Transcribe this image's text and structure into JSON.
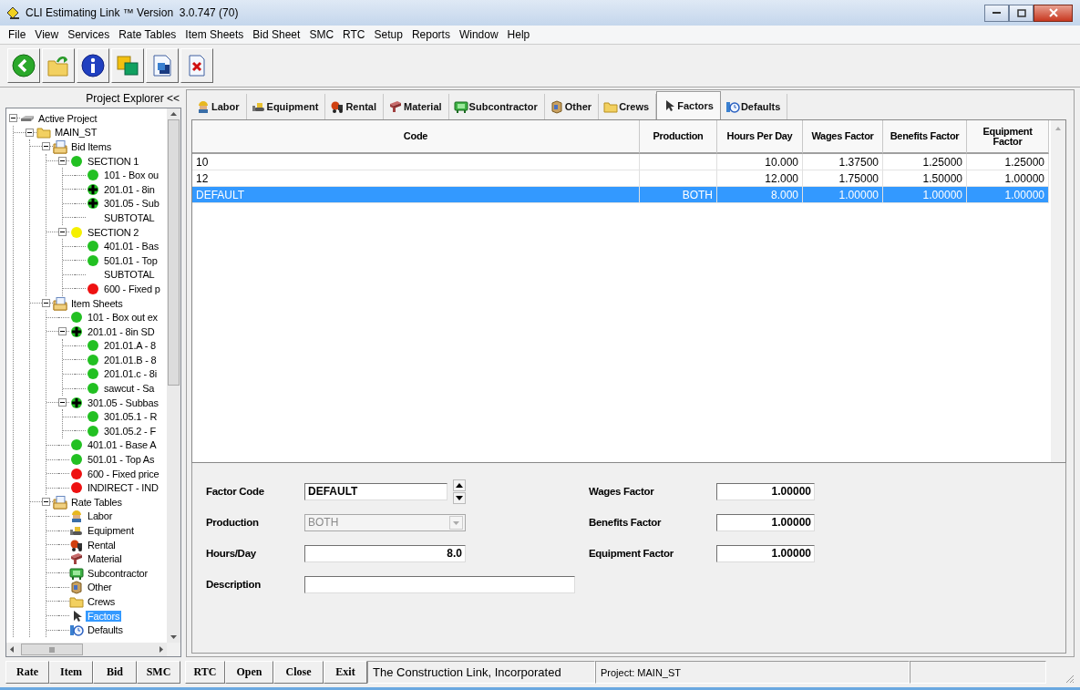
{
  "window": {
    "title": "CLI Estimating Link ™ Version  3.0.747 (70)"
  },
  "menu": [
    "File",
    "View",
    "Services",
    "Rate Tables",
    "Item Sheets",
    "Bid Sheet",
    "SMC",
    "RTC",
    "Setup",
    "Reports",
    "Window",
    "Help"
  ],
  "explorer": {
    "title": "Project Explorer <<",
    "tree": [
      {
        "label": "Active Project",
        "kind": "project",
        "expanded": true,
        "selected": false,
        "children": [
          {
            "label": "MAIN_ST",
            "kind": "folder",
            "expanded": true,
            "selected": false,
            "children": [
              {
                "label": "Bid Items",
                "kind": "sheets",
                "expanded": true,
                "selected": false,
                "children": [
                  {
                    "label": "SECTION 1",
                    "kind": "status",
                    "color": "#22c022",
                    "expanded": true,
                    "selected": false,
                    "children": [
                      {
                        "label": "101 - Box ou",
                        "kind": "status",
                        "color": "#22c022",
                        "selected": false
                      },
                      {
                        "label": "201.01 - 8in",
                        "kind": "assembly",
                        "color": "#22c022",
                        "selected": false
                      },
                      {
                        "label": "301.05 - Sub",
                        "kind": "assembly",
                        "color": "#22c022",
                        "selected": false
                      },
                      {
                        "label": "SUBTOTAL",
                        "kind": "subtotal",
                        "selected": false
                      }
                    ]
                  },
                  {
                    "label": "SECTION 2",
                    "kind": "status",
                    "color": "#f5f000",
                    "expanded": true,
                    "selected": false,
                    "children": [
                      {
                        "label": "401.01 - Bas",
                        "kind": "status",
                        "color": "#22c022",
                        "selected": false
                      },
                      {
                        "label": "501.01 - Top",
                        "kind": "status",
                        "color": "#22c022",
                        "selected": false
                      },
                      {
                        "label": "SUBTOTAL",
                        "kind": "subtotal",
                        "selected": false
                      },
                      {
                        "label": "600 - Fixed p",
                        "kind": "status",
                        "color": "#ee1111",
                        "selected": false
                      }
                    ]
                  }
                ]
              },
              {
                "label": "Item Sheets",
                "kind": "sheets",
                "expanded": true,
                "selected": false,
                "children": [
                  {
                    "label": "101 - Box out ex",
                    "kind": "status",
                    "color": "#22c022",
                    "selected": false
                  },
                  {
                    "label": "201.01 - 8in SD",
                    "kind": "assembly",
                    "color": "#22c022",
                    "expanded": true,
                    "selected": false,
                    "children": [
                      {
                        "label": "201.01.A - 8",
                        "kind": "status",
                        "color": "#22c022",
                        "selected": false
                      },
                      {
                        "label": "201.01.B - 8",
                        "kind": "status",
                        "color": "#22c022",
                        "selected": false
                      },
                      {
                        "label": "201.01.c - 8i",
                        "kind": "status",
                        "color": "#22c022",
                        "selected": false
                      },
                      {
                        "label": "sawcut - Sa",
                        "kind": "status",
                        "color": "#22c022",
                        "selected": false
                      }
                    ]
                  },
                  {
                    "label": "301.05 - Subbas",
                    "kind": "assembly",
                    "color": "#22c022",
                    "expanded": true,
                    "selected": false,
                    "children": [
                      {
                        "label": "301.05.1 - R",
                        "kind": "status",
                        "color": "#22c022",
                        "selected": false
                      },
                      {
                        "label": "301.05.2 - F",
                        "kind": "status",
                        "color": "#22c022",
                        "selected": false
                      }
                    ]
                  },
                  {
                    "label": "401.01 - Base A",
                    "kind": "status",
                    "color": "#22c022",
                    "selected": false
                  },
                  {
                    "label": "501.01 - Top As",
                    "kind": "status",
                    "color": "#22c022",
                    "selected": false
                  },
                  {
                    "label": "600 - Fixed price",
                    "kind": "status",
                    "color": "#ee1111",
                    "selected": false
                  },
                  {
                    "label": "INDIRECT - IND",
                    "kind": "status",
                    "color": "#ee1111",
                    "selected": false
                  }
                ]
              },
              {
                "label": "Rate Tables",
                "kind": "sheets",
                "expanded": true,
                "selected": false,
                "children": [
                  {
                    "label": "Labor",
                    "kind": "rate-table",
                    "selected": false
                  },
                  {
                    "label": "Equipment",
                    "kind": "rate-table",
                    "selected": false
                  },
                  {
                    "label": "Rental",
                    "kind": "rate-table",
                    "selected": false
                  },
                  {
                    "label": "Material",
                    "kind": "rate-table",
                    "selected": false
                  },
                  {
                    "label": "Subcontractor",
                    "kind": "rate-table",
                    "selected": false
                  },
                  {
                    "label": "Other",
                    "kind": "rate-table",
                    "selected": false
                  },
                  {
                    "label": "Crews",
                    "kind": "rate-table",
                    "selected": false
                  },
                  {
                    "label": "Factors",
                    "kind": "rate-table",
                    "selected": true
                  },
                  {
                    "label": "Defaults",
                    "kind": "rate-table",
                    "selected": false
                  }
                ]
              }
            ]
          }
        ]
      }
    ]
  },
  "tabs": [
    {
      "label": "Labor",
      "selected": false
    },
    {
      "label": "Equipment",
      "selected": false
    },
    {
      "label": "Rental",
      "selected": false
    },
    {
      "label": "Material",
      "selected": false
    },
    {
      "label": "Subcontractor",
      "selected": false
    },
    {
      "label": "Other",
      "selected": false
    },
    {
      "label": "Crews",
      "selected": false
    },
    {
      "label": "Factors",
      "selected": true
    },
    {
      "label": "Defaults",
      "selected": false
    }
  ],
  "grid": {
    "columns": [
      "Code",
      "Production",
      "Hours Per Day",
      "Wages Factor",
      "Benefits Factor",
      "Equipment Factor"
    ],
    "rows": [
      {
        "code": "10",
        "hours_per_day": "10.000",
        "wages_factor": "1.37500",
        "benefits_factor": "1.25000",
        "equipment_factor": "1.25000",
        "selected": false
      },
      {
        "code": "12",
        "hours_per_day": "12.000",
        "wages_factor": "1.75000",
        "benefits_factor": "1.50000",
        "equipment_factor": "1.00000",
        "selected": false
      },
      {
        "code": "DEFAULT",
        "production": "BOTH",
        "hours_per_day": "8.000",
        "wages_factor": "1.00000",
        "benefits_factor": "1.00000",
        "equipment_factor": "1.00000",
        "selected": true
      }
    ]
  },
  "form": {
    "fields": [
      {
        "label": "Factor Code",
        "kind": "spinner",
        "value": "DEFAULT",
        "disabled": false
      },
      {
        "label": "Production",
        "kind": "combo",
        "value": "BOTH",
        "disabled": true
      },
      {
        "label": "Hours/Day",
        "kind": "number",
        "value": "8.0",
        "disabled": false
      },
      {
        "label": "Description",
        "kind": "text",
        "disabled": false
      }
    ],
    "factors": [
      {
        "label": "Wages Factor",
        "value": "1.00000"
      },
      {
        "label": "Benefits Factor",
        "value": "1.00000"
      },
      {
        "label": "Equipment Factor",
        "value": "1.00000"
      }
    ]
  },
  "explorer_buttons": [
    "Rate",
    "Item",
    "Bid",
    "SMC"
  ],
  "command_buttons": [
    "RTC",
    "Open",
    "Close",
    "Exit"
  ],
  "status_bar": [
    "The Construction Link, Incorporated",
    "Project: MAIN_ST"
  ]
}
